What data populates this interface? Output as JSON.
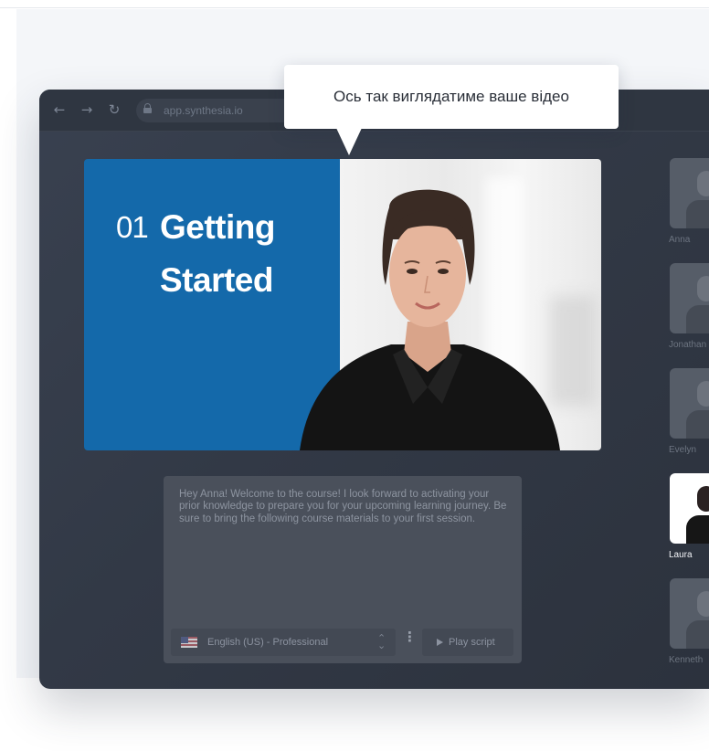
{
  "browser": {
    "url": "app.synthesia.io",
    "back_icon": "←",
    "forward_icon": "→",
    "reload_icon": "↻"
  },
  "tooltip": {
    "text": "Ось так виглядатиме ваше відео"
  },
  "slide": {
    "number": "01",
    "title_line1": "Getting",
    "title_line2": "Started",
    "accent_color": "#1469aa"
  },
  "script": {
    "text": "Hey Anna! Welcome to the course! I look forward to activating your prior knowledge to prepare you for your upcoming learning journey. Be sure to bring the following course materials to your first session.",
    "language": "English (US) - Professional",
    "more_icon": "⋮",
    "chevron_icon": "⌃⌄",
    "play_label": "Play script"
  },
  "avatars": [
    {
      "name": "Anna",
      "selected": false
    },
    {
      "name": "Jonathan",
      "selected": false
    },
    {
      "name": "Evelyn",
      "selected": false
    },
    {
      "name": "Laura",
      "selected": true
    },
    {
      "name": "Kenneth",
      "selected": false
    }
  ]
}
